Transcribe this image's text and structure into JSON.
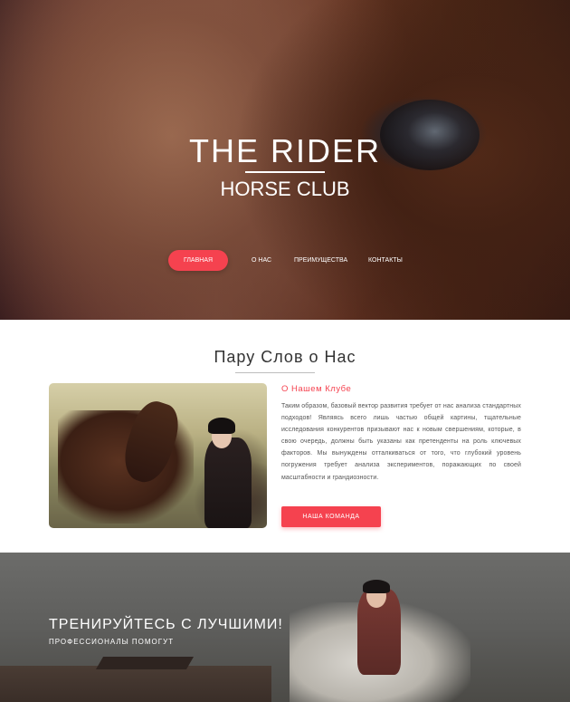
{
  "hero": {
    "title": "THE RIDER",
    "subtitle": "HORSE CLUB"
  },
  "nav": {
    "items": [
      {
        "label": "ГЛАВНАЯ",
        "active": true
      },
      {
        "label": "О НАС",
        "active": false
      },
      {
        "label": "ПРЕИМУЩЕСТВА",
        "active": false
      },
      {
        "label": "КОНТАКТЫ",
        "active": false
      }
    ]
  },
  "about": {
    "title": "Пару Слов о Нас",
    "subtitle": "О Нашем Клубе",
    "text": "Таким образом, базовый вектор развития требует от нас анализа стандартных подходов! Являясь всего лишь частью общей картины, тщательные исследования конкурентов призывают нас к новым свершениям, которые, в свою очередь, должны быть указаны как претенденты на роль ключевых факторов. Мы вынуждены отталкиваться от того, что глубокий уровень погружения требует анализа экспериментов, поражающих по своей масштабности и грандиозности.",
    "button_label": "НАША КОМАНДА"
  },
  "training": {
    "title": "ТРЕНИРУЙТЕСЬ С ЛУЧШИМИ!",
    "subtitle": "ПРОФЕССИОНАЛЫ ПОМОГУТ"
  },
  "colors": {
    "accent": "#f5424f",
    "heading": "#333333",
    "body_text": "#555555"
  }
}
